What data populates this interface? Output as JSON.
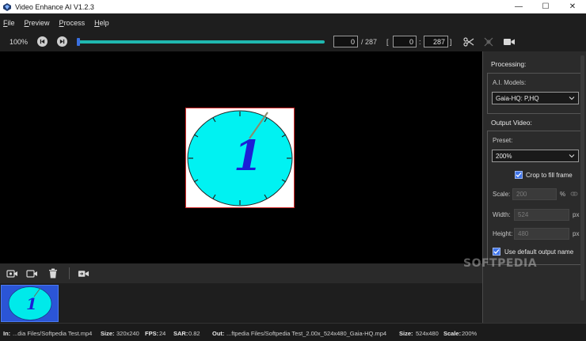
{
  "window": {
    "title": "Video Enhance AI V1.2.3",
    "minimize_glyph": "—",
    "maximize_glyph": "☐",
    "close_glyph": "✕"
  },
  "menu": {
    "items": [
      {
        "label": "File"
      },
      {
        "label": "Preview"
      },
      {
        "label": "Process"
      },
      {
        "label": "Help"
      }
    ]
  },
  "toolbar": {
    "zoom": "100%",
    "playback_progress": 0.0,
    "current_frame": "0",
    "total_frames": "/ 287",
    "range_open_bracket": "[",
    "range_start": "0",
    "range_separator": ":",
    "range_end": "287",
    "range_close_bracket": "]",
    "icons": [
      "skip-back-icon",
      "skip-forward-icon",
      "scissors-icon",
      "split-icon",
      "video-camera-icon"
    ]
  },
  "preview": {
    "clock_numeral": "1"
  },
  "panel": {
    "processing_heading": "Processing:",
    "ai_models_label": "A.I. Models:",
    "ai_model_value": "Gaia-HQ: P,HQ",
    "output_heading": "Output Video:",
    "preset_label": "Preset:",
    "preset_value": "200%",
    "crop_label": "Crop to fill frame",
    "crop_checked": true,
    "scale_label": "Scale:",
    "scale_value": "200",
    "scale_unit": "%",
    "width_label": "Width:",
    "width_value": "524",
    "width_unit": "px",
    "height_label": "Height:",
    "height_value": "480",
    "height_unit": "px",
    "default_output_label": "Use default output name",
    "default_output_checked": true
  },
  "clip_toolbar": {
    "icons": [
      "add-video-icon",
      "camera-icon",
      "trash-icon",
      "export-video-icon"
    ]
  },
  "thumbnail": {
    "numeral": "1"
  },
  "status": {
    "in_label": "In:",
    "in_value": "...dia Files/Softpedia Test.mp4",
    "size_label": "Size:",
    "size_value": "320x240",
    "fps_label": "FPS:",
    "fps_value": "24",
    "sar_label": "SAR:",
    "sar_value": "0.82",
    "out_label": "Out:",
    "out_value": "...ftpedia Files/Softpedia Test_2.00x_524x480_Gaia-HQ.mp4",
    "out_size_label": "Size:",
    "out_size_value": "524x480",
    "scale_label": "Scale:",
    "scale_value": "200%"
  },
  "watermark": "SOFTPEDIA",
  "colors": {
    "accent": "#3f74e8",
    "timeline": "#20b8b0",
    "selection_border": "#d42a2a",
    "clock_face": "#00f2f2"
  }
}
